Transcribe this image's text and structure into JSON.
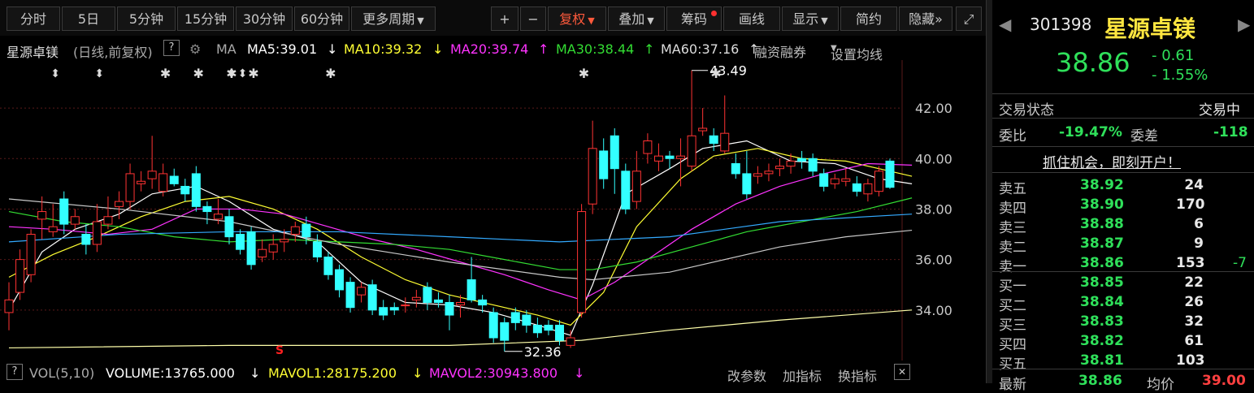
{
  "toolbar": {
    "periods": [
      "分时",
      "5日",
      "5分钟",
      "15分钟",
      "30分钟",
      "60分钟",
      "更多周期"
    ],
    "plus": "+",
    "minus": "−",
    "fuquan": "复权",
    "diejia": "叠加",
    "chouma": "筹码",
    "huaxian": "画线",
    "xianshi": "显示",
    "jianyue": "简约",
    "yincang": "隐藏",
    "more_icon": "»",
    "expand_icon": "⤢"
  },
  "indicator": {
    "stock_label": "星源卓镁",
    "mode": "(日线,前复权)",
    "help": "?",
    "ma_label": "MA",
    "ma5": "MA5:39.01",
    "ma10": "MA10:39.32",
    "ma20": "MA20:39.74",
    "ma30": "MA30:38.44",
    "ma60": "MA60:37.16",
    "margin": "融资融券",
    "setma": "设置均线"
  },
  "colors": {
    "ma5": "#ffffff",
    "ma10": "#ffff33",
    "ma20": "#ff33ff",
    "ma30": "#33dd33",
    "ma60": "#c8c8c8",
    "ma120": "#33aaff",
    "ma250": "#ffffaa",
    "up": "#ff3333",
    "down": "#33ffff",
    "grid": "#5a1a1a"
  },
  "chart_data": {
    "type": "candlestick",
    "y_ticks": [
      "42.00",
      "40.00",
      "38.00",
      "36.00",
      "34.00"
    ],
    "ylim": [
      32.0,
      43.9
    ],
    "high_label": "43.49",
    "low_label": "32.36",
    "candles": [
      {
        "o": 33.9,
        "c": 34.4,
        "h": 35.1,
        "l": 33.2
      },
      {
        "o": 34.7,
        "c": 36.0,
        "h": 36.4,
        "l": 34.4
      },
      {
        "o": 35.4,
        "c": 37.0,
        "h": 37.2,
        "l": 35.1
      },
      {
        "o": 37.6,
        "c": 37.9,
        "h": 38.5,
        "l": 36.8
      },
      {
        "o": 37.1,
        "c": 37.3,
        "h": 38.2,
        "l": 36.9
      },
      {
        "o": 38.4,
        "c": 37.4,
        "h": 38.7,
        "l": 37.0
      },
      {
        "o": 37.4,
        "c": 37.7,
        "h": 38.0,
        "l": 37.2
      },
      {
        "o": 37.0,
        "c": 36.6,
        "h": 37.4,
        "l": 36.2
      },
      {
        "o": 36.6,
        "c": 37.5,
        "h": 38.2,
        "l": 36.3
      },
      {
        "o": 37.4,
        "c": 37.7,
        "h": 38.5,
        "l": 37.2
      },
      {
        "o": 38.1,
        "c": 38.3,
        "h": 38.7,
        "l": 37.6
      },
      {
        "o": 38.3,
        "c": 39.4,
        "h": 39.8,
        "l": 38.0
      },
      {
        "o": 39.0,
        "c": 39.1,
        "h": 39.5,
        "l": 38.7
      },
      {
        "o": 39.2,
        "c": 39.5,
        "h": 40.9,
        "l": 38.8
      },
      {
        "o": 38.7,
        "c": 39.4,
        "h": 39.8,
        "l": 38.5
      },
      {
        "o": 39.3,
        "c": 39.0,
        "h": 39.6,
        "l": 38.9
      },
      {
        "o": 38.9,
        "c": 38.6,
        "h": 39.2,
        "l": 38.3
      },
      {
        "o": 39.4,
        "c": 38.1,
        "h": 39.7,
        "l": 37.9
      },
      {
        "o": 38.1,
        "c": 37.9,
        "h": 38.3,
        "l": 37.4
      },
      {
        "o": 37.6,
        "c": 37.8,
        "h": 38.4,
        "l": 37.4
      },
      {
        "o": 37.7,
        "c": 36.9,
        "h": 38.0,
        "l": 36.6
      },
      {
        "o": 37.0,
        "c": 36.4,
        "h": 37.2,
        "l": 36.2
      },
      {
        "o": 37.1,
        "c": 35.8,
        "h": 37.3,
        "l": 35.6
      },
      {
        "o": 36.1,
        "c": 36.4,
        "h": 36.8,
        "l": 35.9
      },
      {
        "o": 36.3,
        "c": 36.6,
        "h": 37.0,
        "l": 36.0
      },
      {
        "o": 36.7,
        "c": 36.8,
        "h": 37.2,
        "l": 36.3
      },
      {
        "o": 37.0,
        "c": 37.3,
        "h": 37.5,
        "l": 36.7
      },
      {
        "o": 37.4,
        "c": 36.9,
        "h": 37.7,
        "l": 36.6
      },
      {
        "o": 36.7,
        "c": 36.1,
        "h": 37.0,
        "l": 35.9
      },
      {
        "o": 36.1,
        "c": 35.4,
        "h": 36.3,
        "l": 35.2
      },
      {
        "o": 35.6,
        "c": 34.8,
        "h": 35.8,
        "l": 34.5
      },
      {
        "o": 35.1,
        "c": 34.1,
        "h": 35.3,
        "l": 33.9
      },
      {
        "o": 34.6,
        "c": 34.9,
        "h": 35.1,
        "l": 34.3
      },
      {
        "o": 35.0,
        "c": 34.0,
        "h": 35.2,
        "l": 33.8
      },
      {
        "o": 34.1,
        "c": 33.8,
        "h": 34.4,
        "l": 33.6
      },
      {
        "o": 34.1,
        "c": 34.0,
        "h": 34.3,
        "l": 33.8
      },
      {
        "o": 34.2,
        "c": 34.2,
        "h": 34.5,
        "l": 33.9
      },
      {
        "o": 34.4,
        "c": 34.5,
        "h": 34.8,
        "l": 34.1
      },
      {
        "o": 34.9,
        "c": 34.3,
        "h": 35.1,
        "l": 34.0
      },
      {
        "o": 34.4,
        "c": 34.3,
        "h": 34.7,
        "l": 34.1
      },
      {
        "o": 34.3,
        "c": 33.8,
        "h": 34.6,
        "l": 33.2
      },
      {
        "o": 34.2,
        "c": 34.3,
        "h": 34.6,
        "l": 33.7
      },
      {
        "o": 35.2,
        "c": 34.4,
        "h": 36.1,
        "l": 34.3
      },
      {
        "o": 34.4,
        "c": 34.2,
        "h": 34.6,
        "l": 33.9
      },
      {
        "o": 33.9,
        "c": 32.9,
        "h": 34.1,
        "l": 32.7
      },
      {
        "o": 33.5,
        "c": 32.8,
        "h": 33.7,
        "l": 32.36
      },
      {
        "o": 33.9,
        "c": 33.5,
        "h": 34.1,
        "l": 33.2
      },
      {
        "o": 33.8,
        "c": 33.4,
        "h": 34.0,
        "l": 33.1
      },
      {
        "o": 33.4,
        "c": 33.1,
        "h": 33.7,
        "l": 32.9
      },
      {
        "o": 33.4,
        "c": 33.2,
        "h": 33.6,
        "l": 33.0
      },
      {
        "o": 33.4,
        "c": 32.8,
        "h": 33.6,
        "l": 32.6
      },
      {
        "o": 32.6,
        "c": 32.9,
        "h": 33.2,
        "l": 32.5
      },
      {
        "o": 33.9,
        "c": 37.9,
        "h": 38.2,
        "l": 33.7
      },
      {
        "o": 38.2,
        "c": 40.4,
        "h": 41.5,
        "l": 37.8
      },
      {
        "o": 40.3,
        "c": 39.2,
        "h": 40.8,
        "l": 38.8
      },
      {
        "o": 40.9,
        "c": 39.6,
        "h": 41.2,
        "l": 38.6
      },
      {
        "o": 39.5,
        "c": 38.0,
        "h": 39.8,
        "l": 37.8
      },
      {
        "o": 38.3,
        "c": 39.5,
        "h": 40.3,
        "l": 38.0
      },
      {
        "o": 40.2,
        "c": 40.7,
        "h": 41.0,
        "l": 39.8
      },
      {
        "o": 39.9,
        "c": 40.1,
        "h": 40.6,
        "l": 39.5
      },
      {
        "o": 40.1,
        "c": 40.0,
        "h": 40.3,
        "l": 39.6
      },
      {
        "o": 40.0,
        "c": 40.1,
        "h": 40.8,
        "l": 38.9
      },
      {
        "o": 39.7,
        "c": 40.9,
        "h": 43.49,
        "l": 39.5
      },
      {
        "o": 41.1,
        "c": 41.2,
        "h": 42.0,
        "l": 40.9
      },
      {
        "o": 40.9,
        "c": 40.6,
        "h": 41.2,
        "l": 40.3
      },
      {
        "o": 40.3,
        "c": 41.0,
        "h": 42.5,
        "l": 40.2
      },
      {
        "o": 39.8,
        "c": 39.4,
        "h": 40.2,
        "l": 39.2
      },
      {
        "o": 39.4,
        "c": 38.6,
        "h": 40.3,
        "l": 38.4
      },
      {
        "o": 39.3,
        "c": 39.4,
        "h": 39.7,
        "l": 39.0
      },
      {
        "o": 39.4,
        "c": 39.5,
        "h": 39.8,
        "l": 39.1
      },
      {
        "o": 39.6,
        "c": 39.7,
        "h": 40.0,
        "l": 39.3
      },
      {
        "o": 39.7,
        "c": 39.9,
        "h": 40.2,
        "l": 39.4
      },
      {
        "o": 40.0,
        "c": 39.9,
        "h": 40.3,
        "l": 39.6
      },
      {
        "o": 40.0,
        "c": 39.5,
        "h": 40.2,
        "l": 39.3
      },
      {
        "o": 39.4,
        "c": 38.9,
        "h": 39.6,
        "l": 38.7
      },
      {
        "o": 39.0,
        "c": 39.2,
        "h": 39.4,
        "l": 38.8
      },
      {
        "o": 39.1,
        "c": 39.2,
        "h": 39.6,
        "l": 38.9
      },
      {
        "o": 39.0,
        "c": 38.7,
        "h": 39.3,
        "l": 38.5
      },
      {
        "o": 38.6,
        "c": 39.0,
        "h": 39.2,
        "l": 38.3
      },
      {
        "o": 38.7,
        "c": 39.5,
        "h": 39.7,
        "l": 38.5
      },
      {
        "o": 39.9,
        "c": 38.86,
        "h": 40.0,
        "l": 38.8
      }
    ],
    "ma_lines": {
      "ma5": [
        [
          0,
          34.0
        ],
        [
          3,
          36.3
        ],
        [
          6,
          37.2
        ],
        [
          10,
          37.8
        ],
        [
          13,
          38.6
        ],
        [
          17,
          38.9
        ],
        [
          20,
          38.3
        ],
        [
          24,
          37.2
        ],
        [
          28,
          36.7
        ],
        [
          32,
          35.1
        ],
        [
          36,
          34.3
        ],
        [
          40,
          34.2
        ],
        [
          44,
          33.9
        ],
        [
          48,
          33.4
        ],
        [
          51,
          33.0
        ],
        [
          53,
          35.0
        ],
        [
          56,
          38.6
        ],
        [
          60,
          39.6
        ],
        [
          63,
          40.4
        ],
        [
          67,
          40.7
        ],
        [
          71,
          39.9
        ],
        [
          75,
          39.8
        ],
        [
          79,
          39.2
        ],
        [
          82,
          39.0
        ]
      ],
      "ma10": [
        [
          0,
          35.3
        ],
        [
          4,
          36.2
        ],
        [
          8,
          36.9
        ],
        [
          12,
          37.7
        ],
        [
          16,
          38.3
        ],
        [
          20,
          38.5
        ],
        [
          24,
          38.0
        ],
        [
          28,
          37.2
        ],
        [
          32,
          36.1
        ],
        [
          36,
          35.2
        ],
        [
          40,
          34.6
        ],
        [
          44,
          34.2
        ],
        [
          48,
          33.8
        ],
        [
          51,
          33.4
        ],
        [
          54,
          34.7
        ],
        [
          57,
          37.3
        ],
        [
          61,
          39.2
        ],
        [
          64,
          40.1
        ],
        [
          68,
          40.4
        ],
        [
          72,
          40.0
        ],
        [
          76,
          39.9
        ],
        [
          80,
          39.5
        ],
        [
          82,
          39.3
        ]
      ],
      "ma20": [
        [
          0,
          37.3
        ],
        [
          4,
          37.2
        ],
        [
          9,
          37.0
        ],
        [
          13,
          37.2
        ],
        [
          17,
          38.0
        ],
        [
          21,
          38.0
        ],
        [
          25,
          37.8
        ],
        [
          29,
          37.3
        ],
        [
          33,
          36.8
        ],
        [
          37,
          36.4
        ],
        [
          41,
          35.9
        ],
        [
          45,
          35.4
        ],
        [
          49,
          34.8
        ],
        [
          52,
          34.4
        ],
        [
          55,
          35.1
        ],
        [
          58,
          36.0
        ],
        [
          62,
          37.2
        ],
        [
          66,
          38.2
        ],
        [
          70,
          38.9
        ],
        [
          74,
          39.4
        ],
        [
          78,
          39.8
        ],
        [
          82,
          39.74
        ]
      ],
      "ma30": [
        [
          0,
          37.9
        ],
        [
          5,
          37.5
        ],
        [
          10,
          37.3
        ],
        [
          15,
          36.9
        ],
        [
          20,
          36.7
        ],
        [
          25,
          36.8
        ],
        [
          30,
          36.7
        ],
        [
          35,
          36.6
        ],
        [
          40,
          36.4
        ],
        [
          45,
          36.0
        ],
        [
          50,
          35.6
        ],
        [
          53,
          35.6
        ],
        [
          57,
          35.9
        ],
        [
          62,
          36.5
        ],
        [
          67,
          37.1
        ],
        [
          72,
          37.5
        ],
        [
          77,
          37.9
        ],
        [
          82,
          38.44
        ]
      ],
      "ma60": [
        [
          0,
          38.4
        ],
        [
          10,
          38.0
        ],
        [
          20,
          37.5
        ],
        [
          30,
          36.6
        ],
        [
          40,
          35.9
        ],
        [
          50,
          35.3
        ],
        [
          53,
          35.2
        ],
        [
          60,
          35.5
        ],
        [
          70,
          36.5
        ],
        [
          76,
          36.9
        ],
        [
          82,
          37.16
        ]
      ],
      "ma120": [
        [
          0,
          36.7
        ],
        [
          10,
          37.0
        ],
        [
          20,
          37.1
        ],
        [
          30,
          37.1
        ],
        [
          40,
          36.9
        ],
        [
          50,
          36.7
        ],
        [
          60,
          36.9
        ],
        [
          70,
          37.5
        ],
        [
          82,
          37.8
        ]
      ],
      "ma250": [
        [
          0,
          32.5
        ],
        [
          20,
          32.6
        ],
        [
          40,
          32.6
        ],
        [
          52,
          32.8
        ],
        [
          60,
          33.2
        ],
        [
          70,
          33.6
        ],
        [
          82,
          34.0
        ]
      ]
    },
    "markers": {
      "diamond_idx": [
        2,
        6,
        18,
        19
      ],
      "asterisk_idx": [
        12,
        15,
        18,
        20,
        27,
        50,
        62
      ]
    }
  },
  "volume": {
    "help": "?",
    "name": "VOL(5,10)",
    "volume": "VOLUME:13765.000",
    "mavol1": "MAVOL1:28175.200",
    "mavol2": "MAVOL2:30943.800",
    "gaicanshu": "改参数",
    "jiazhibiao": "加指标",
    "huanzhibiao": "换指标",
    "s_marker": "S"
  },
  "quote": {
    "code": "301398",
    "name": "星源卓镁",
    "price": "38.86",
    "change": "- 0.61",
    "pct": "- 1.55%",
    "status_label": "交易状态",
    "status": "交易中",
    "weibi_label": "委比",
    "weibi": "-19.47%",
    "weicha_label": "委差",
    "weicha": "-118",
    "promo": "抓住机会，即刻开户！",
    "asks": [
      {
        "label": "卖五",
        "price": "38.92",
        "vol": "24",
        "extra": ""
      },
      {
        "label": "卖四",
        "price": "38.90",
        "vol": "170",
        "extra": ""
      },
      {
        "label": "卖三",
        "price": "38.88",
        "vol": "6",
        "extra": ""
      },
      {
        "label": "卖二",
        "price": "38.87",
        "vol": "9",
        "extra": ""
      },
      {
        "label": "卖一",
        "price": "38.86",
        "vol": "153",
        "extra": "-7"
      }
    ],
    "bids": [
      {
        "label": "买一",
        "price": "38.85",
        "vol": "22"
      },
      {
        "label": "买二",
        "price": "38.84",
        "vol": "26"
      },
      {
        "label": "买三",
        "price": "38.83",
        "vol": "32"
      },
      {
        "label": "买四",
        "price": "38.82",
        "vol": "61"
      },
      {
        "label": "买五",
        "price": "38.81",
        "vol": "103"
      }
    ],
    "last_label": "最新",
    "last": "38.86",
    "avg_label": "均价",
    "avg": "39.00"
  }
}
